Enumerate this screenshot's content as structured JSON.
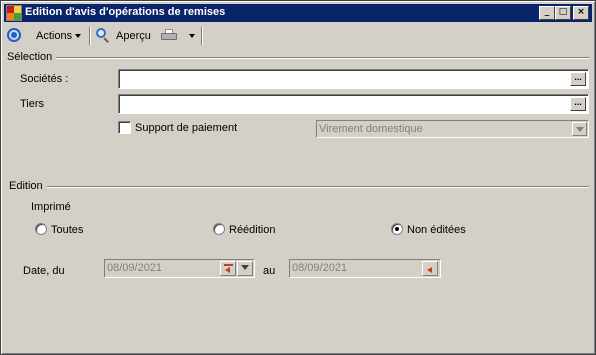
{
  "window": {
    "title": "Edition d'avis d'opérations de remises",
    "controls": {
      "minimize": "_",
      "maximize": "□",
      "close": "×"
    }
  },
  "toolbar": {
    "actions_label": "Actions",
    "apercu_label": "Aperçu",
    "icons": [
      "ring-icon",
      "magnifier-icon",
      "printer-icon"
    ]
  },
  "selection": {
    "group_label": "Sélection",
    "societes_label": "Sociétés :",
    "societes_value": "",
    "tiers_label": "Tiers",
    "tiers_value": "",
    "ellipsis": "...",
    "support_label": "Support de paiement",
    "support_checked": false,
    "support_combo_value": "Virement domestique"
  },
  "edition": {
    "group_label": "Edition",
    "imprime_label": "Imprimé",
    "radios": [
      {
        "label": "Toutes",
        "checked": false
      },
      {
        "label": "Réédition",
        "checked": false
      },
      {
        "label": "Non éditées",
        "checked": true
      }
    ],
    "date_du_label": "Date, du",
    "date_du_value": "08/09/2021",
    "au_label": "au",
    "date_au_value": "08/09/2021"
  }
}
